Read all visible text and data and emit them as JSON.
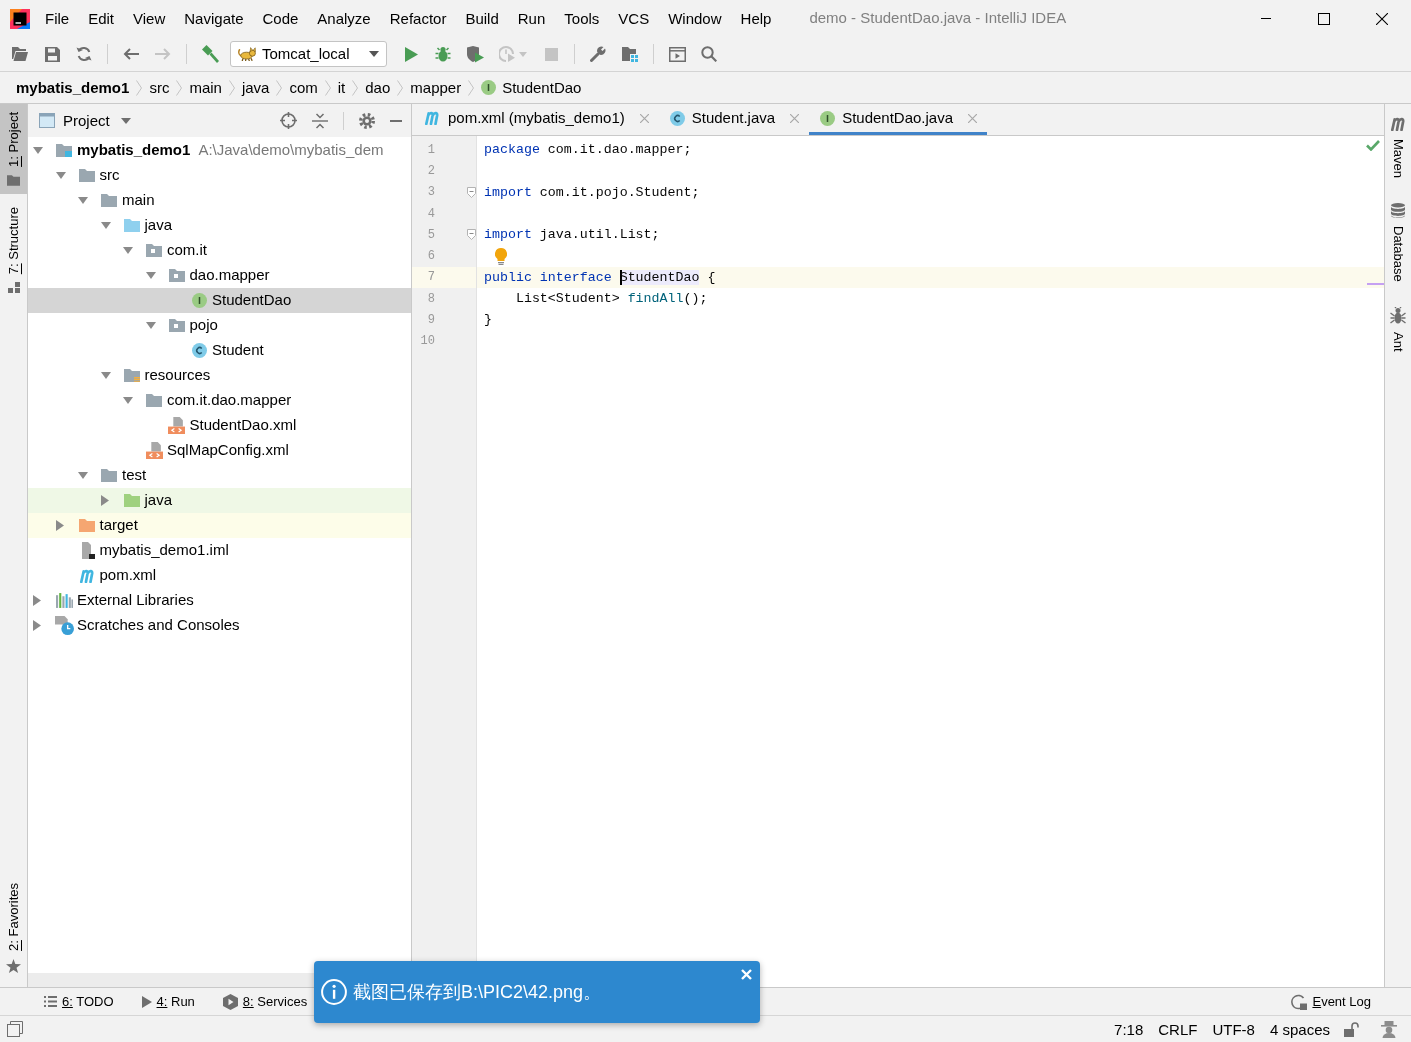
{
  "window": {
    "title": "demo - StudentDao.java - IntelliJ IDEA"
  },
  "menu": [
    "File",
    "Edit",
    "View",
    "Navigate",
    "Code",
    "Analyze",
    "Refactor",
    "Build",
    "Run",
    "Tools",
    "VCS",
    "Window",
    "Help"
  ],
  "toolbar": {
    "buttons": [
      {
        "disabled": false
      },
      {
        "disabled": false
      },
      {
        "disabled": false
      },
      {
        "disabled": false
      },
      {
        "disabled": true
      },
      {
        "disabled": false
      },
      {
        "disabled": false
      },
      {
        "disabled": false
      },
      {
        "disabled": false
      },
      {
        "disabled": true
      },
      {
        "disabled": true
      },
      {
        "disabled": false
      },
      {
        "disabled": false
      },
      {
        "disabled": false
      },
      {
        "disabled": false
      }
    ],
    "run_configuration": "Tomcat_local"
  },
  "breadcrumbs": [
    {
      "label": "mybatis_demo1",
      "kind": "module"
    },
    {
      "label": "src",
      "kind": "folder"
    },
    {
      "label": "main",
      "kind": "folder"
    },
    {
      "label": "java",
      "kind": "folder"
    },
    {
      "label": "com",
      "kind": "folder"
    },
    {
      "label": "it",
      "kind": "folder"
    },
    {
      "label": "dao",
      "kind": "folder"
    },
    {
      "label": "mapper",
      "kind": "folder"
    },
    {
      "label": "StudentDao",
      "kind": "interface"
    }
  ],
  "tool_windows": {
    "left_top": [
      {
        "label": "1: Project",
        "selected": true
      },
      {
        "label": "7: Structure",
        "selected": false
      }
    ],
    "left_bottom": [
      {
        "label": "2: Favorites",
        "selected": false
      }
    ],
    "right": [
      {
        "label": "Maven",
        "selected": false
      },
      {
        "label": "Database",
        "selected": false
      },
      {
        "label": "Ant",
        "selected": false
      }
    ],
    "bottom_left": [
      {
        "label": "6: TODO",
        "selected": false
      },
      {
        "label": "4: Run",
        "selected": false
      },
      {
        "label": "8: Services",
        "selected": false
      }
    ],
    "bottom_right": [
      {
        "label": "Event Log",
        "selected": false
      }
    ]
  },
  "project_panel": {
    "title": "Project",
    "tree": [
      {
        "label": "mybatis_demo1",
        "path": "A:\\Java\\demo\\mybatis_dem",
        "kind": "module",
        "expanded": true,
        "selected": false,
        "children": [
          {
            "label": "src",
            "kind": "folder",
            "expanded": true,
            "selected": false,
            "children": [
              {
                "label": "main",
                "kind": "folder",
                "expanded": true,
                "selected": false,
                "children": [
                  {
                    "label": "java",
                    "kind": "source-folder",
                    "expanded": true,
                    "selected": false,
                    "children": [
                      {
                        "label": "com.it",
                        "kind": "package",
                        "expanded": true,
                        "selected": false,
                        "children": [
                          {
                            "label": "dao.mapper",
                            "kind": "package",
                            "expanded": true,
                            "selected": false,
                            "children": [
                              {
                                "label": "StudentDao",
                                "kind": "interface",
                                "selected": true
                              }
                            ]
                          },
                          {
                            "label": "pojo",
                            "kind": "package",
                            "expanded": true,
                            "selected": false,
                            "children": [
                              {
                                "label": "Student",
                                "kind": "class",
                                "selected": false
                              }
                            ]
                          }
                        ]
                      }
                    ]
                  },
                  {
                    "label": "resources",
                    "kind": "resources-folder",
                    "expanded": true,
                    "selected": false,
                    "children": [
                      {
                        "label": "com.it.dao.mapper",
                        "kind": "folder",
                        "expanded": true,
                        "selected": false,
                        "children": [
                          {
                            "label": "StudentDao.xml",
                            "kind": "xml",
                            "selected": false
                          }
                        ]
                      },
                      {
                        "label": "SqlMapConfig.xml",
                        "kind": "xml",
                        "selected": false
                      }
                    ]
                  }
                ]
              },
              {
                "label": "test",
                "kind": "folder",
                "expanded": true,
                "selected": false,
                "children": [
                  {
                    "label": "java",
                    "kind": "test-folder",
                    "expanded": false,
                    "selected": false
                  }
                ]
              }
            ]
          },
          {
            "label": "target",
            "kind": "excluded-folder",
            "expanded": false,
            "selected": false
          },
          {
            "label": "mybatis_demo1.iml",
            "kind": "iml",
            "selected": false
          },
          {
            "label": "pom.xml",
            "kind": "maven",
            "selected": false
          }
        ]
      },
      {
        "label": "External Libraries",
        "kind": "libraries",
        "expanded": false,
        "selected": false
      },
      {
        "label": "Scratches and Consoles",
        "kind": "scratches",
        "expanded": false,
        "selected": false
      }
    ]
  },
  "editor": {
    "tabs": [
      {
        "label": "pom.xml (mybatis_demo1)",
        "kind": "maven",
        "selected": false
      },
      {
        "label": "Student.java",
        "kind": "class",
        "selected": false
      },
      {
        "label": "StudentDao.java",
        "kind": "interface",
        "selected": true
      }
    ],
    "lines": [
      {
        "number": "1",
        "current": false,
        "fold": false,
        "bulb": false,
        "tokens": [
          {
            "text": "package",
            "kind": "keyword"
          },
          {
            "text": " com.it.dao.mapper;",
            "kind": "plain"
          }
        ]
      },
      {
        "number": "2",
        "current": false,
        "fold": false,
        "bulb": false
      },
      {
        "number": "3",
        "current": false,
        "fold": true,
        "bulb": false,
        "tokens": [
          {
            "text": "import",
            "kind": "keyword"
          },
          {
            "text": " com.it.pojo.Student;",
            "kind": "plain"
          }
        ]
      },
      {
        "number": "4",
        "current": false,
        "fold": false,
        "bulb": false
      },
      {
        "number": "5",
        "current": false,
        "fold": true,
        "bulb": false,
        "tokens": [
          {
            "text": "import",
            "kind": "keyword"
          },
          {
            "text": " java.util.List;",
            "kind": "plain"
          }
        ]
      },
      {
        "number": "6",
        "current": false,
        "fold": false,
        "bulb": true
      },
      {
        "number": "7",
        "current": true,
        "fold": false,
        "bulb": false,
        "tokens": [
          {
            "text": "public ",
            "kind": "keyword"
          },
          {
            "text": "interface ",
            "kind": "keyword"
          },
          {
            "text": "StudentDao",
            "kind": "caret-usage"
          },
          {
            "text": " {",
            "kind": "plain"
          }
        ]
      },
      {
        "number": "8",
        "current": false,
        "fold": false,
        "bulb": false,
        "tokens": [
          {
            "text": "    List<Student> ",
            "kind": "plain"
          },
          {
            "text": "findAll",
            "kind": "method"
          },
          {
            "text": "();",
            "kind": "plain"
          }
        ]
      },
      {
        "number": "9",
        "current": false,
        "fold": false,
        "bulb": false,
        "tokens": [
          {
            "text": "}",
            "kind": "plain"
          }
        ]
      },
      {
        "number": "10",
        "current": false,
        "fold": false,
        "bulb": false
      }
    ]
  },
  "status_bar": [
    "7:18",
    "CRLF",
    "UTF-8",
    "4 spaces"
  ],
  "notification": {
    "message": "截图已保存到B:\\PIC2\\42.png。"
  }
}
